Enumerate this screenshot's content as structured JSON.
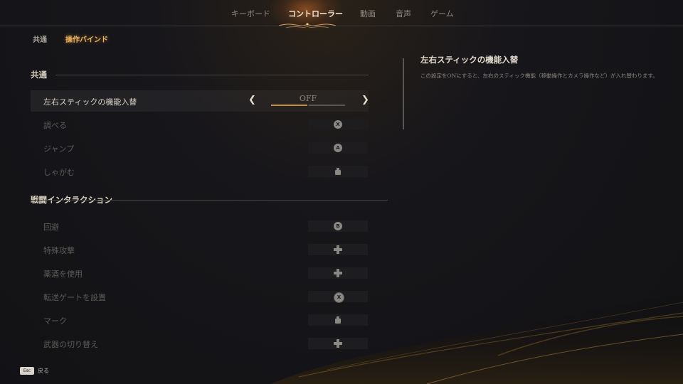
{
  "top_tabs": [
    "キーボード",
    "コントローラー",
    "動画",
    "音声",
    "ゲーム"
  ],
  "active_top_tab": "コントローラー",
  "sub_tabs": [
    "共通",
    "操作バインド"
  ],
  "active_sub_tab": "操作バインド",
  "sections": [
    {
      "title": "共通",
      "rows": [
        {
          "label": "左右スティックの機能入替",
          "type": "option",
          "value": "OFF",
          "selected": true
        },
        {
          "label": "調べる",
          "type": "binding",
          "icon": "x-button-icon",
          "glyph": "X"
        },
        {
          "label": "ジャンプ",
          "type": "binding",
          "icon": "a-button-icon",
          "glyph": "A"
        },
        {
          "label": "しゃがむ",
          "type": "binding",
          "icon": "left-stick-click-icon",
          "glyph": ""
        }
      ]
    },
    {
      "title": "戦闘インタラクション",
      "rows": [
        {
          "label": "回避",
          "type": "binding",
          "icon": "b-button-icon",
          "glyph": "B"
        },
        {
          "label": "特殊攻撃",
          "type": "binding",
          "icon": "dpad-icon",
          "glyph": ""
        },
        {
          "label": "薬酒を使用",
          "type": "binding",
          "icon": "dpad-icon",
          "glyph": ""
        },
        {
          "label": "転送ゲートを設置",
          "type": "binding",
          "icon": "x-button-icon",
          "glyph": "X"
        },
        {
          "label": "マーク",
          "type": "binding",
          "icon": "right-stick-click-icon",
          "glyph": ""
        },
        {
          "label": "武器の切り替え",
          "type": "binding",
          "icon": "dpad-icon",
          "glyph": ""
        }
      ]
    }
  ],
  "description": {
    "title": "左右スティックの機能入替",
    "body": "この設定をONにすると、左右のスティック機能（移動操作とカメラ操作など）が入れ替わります。"
  },
  "footer": {
    "key": "Esc",
    "label": "戻る"
  },
  "colors": {
    "accent": "#e8b55e",
    "bar_fill": "#c98a42",
    "background": "#141417"
  }
}
